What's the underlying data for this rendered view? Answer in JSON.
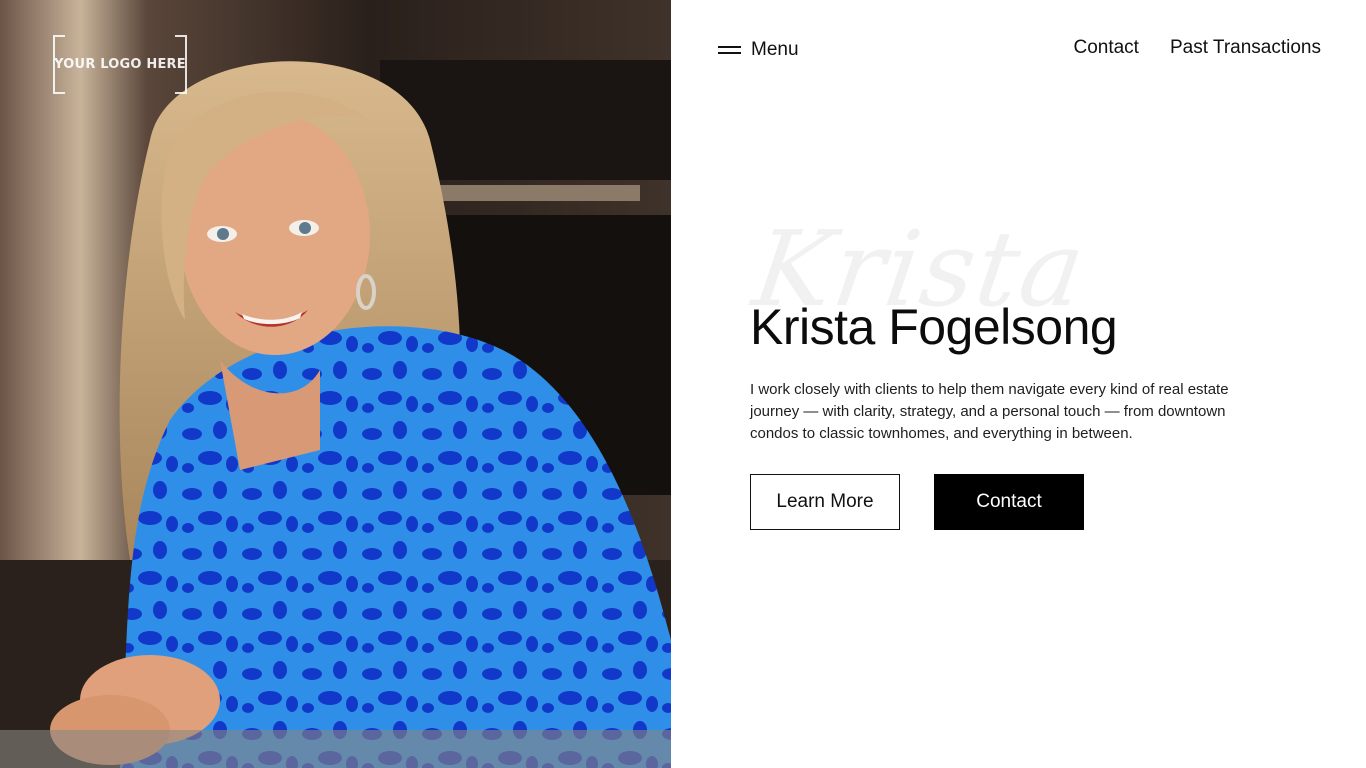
{
  "logo": {
    "text": "YOUR LOGO HERE"
  },
  "header": {
    "menu_label": "Menu",
    "links": [
      {
        "label": "Contact"
      },
      {
        "label": "Past Transactions"
      }
    ]
  },
  "hero": {
    "script_text": "Krista",
    "title": "Krista Fogelsong",
    "description": "I work closely with clients to help them navigate every kind of real estate journey — with clarity, strategy, and a personal touch — from downtown condos to classic townhomes, and everything in between.",
    "buttons": {
      "learn_more": "Learn More",
      "contact": "Contact"
    }
  },
  "icons": {
    "menu": "hamburger-icon"
  },
  "colors": {
    "background": "#ffffff",
    "text": "#111111",
    "button_solid": "#000000",
    "photo_blouse": "#1f6fe0"
  }
}
